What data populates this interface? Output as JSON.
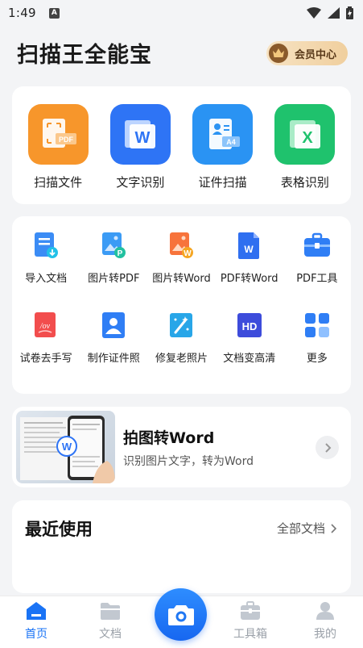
{
  "status_bar": {
    "time": "1:49",
    "notification_letter": "A"
  },
  "header": {
    "title": "扫描王全能宝",
    "vip_label": "会员中心"
  },
  "main_features": [
    {
      "label": "扫描文件",
      "color": "#f7962b",
      "badge": "PDF"
    },
    {
      "label": "文字识别",
      "color": "#2e74f5",
      "badge": "W"
    },
    {
      "label": "证件扫描",
      "color": "#2a93f3",
      "badge": "A4"
    },
    {
      "label": "表格识别",
      "color": "#1fc26d",
      "badge": "X"
    }
  ],
  "tools": [
    {
      "label": "导入文档",
      "icon": "import-doc-icon"
    },
    {
      "label": "图片转PDF",
      "icon": "image-to-pdf-icon",
      "badge": "P"
    },
    {
      "label": "图片转Word",
      "icon": "image-to-word-icon",
      "badge": "W"
    },
    {
      "label": "PDF转Word",
      "icon": "pdf-to-word-icon",
      "badge": "W"
    },
    {
      "label": "PDF工具",
      "icon": "toolbox-icon"
    },
    {
      "label": "试卷去手写",
      "icon": "remove-handwriting-icon",
      "badge": "/ov"
    },
    {
      "label": "制作证件照",
      "icon": "id-photo-icon"
    },
    {
      "label": "修复老照片",
      "icon": "photo-restore-icon"
    },
    {
      "label": "文档变高清",
      "icon": "hd-icon",
      "badge": "HD"
    },
    {
      "label": "更多",
      "icon": "grid-more-icon"
    }
  ],
  "promo": {
    "title": "拍图转Word",
    "subtitle": "识别图片文字，转为Word",
    "image_badge": "W"
  },
  "recent": {
    "title": "最近使用",
    "all_label": "全部文档"
  },
  "bottom_nav": [
    {
      "label": "首页",
      "active": true
    },
    {
      "label": "文档",
      "active": false
    },
    {
      "label": "工具箱",
      "active": false
    },
    {
      "label": "我的",
      "active": false
    }
  ],
  "colors": {
    "accent": "#1a73f5",
    "background": "#f3f4f6"
  }
}
